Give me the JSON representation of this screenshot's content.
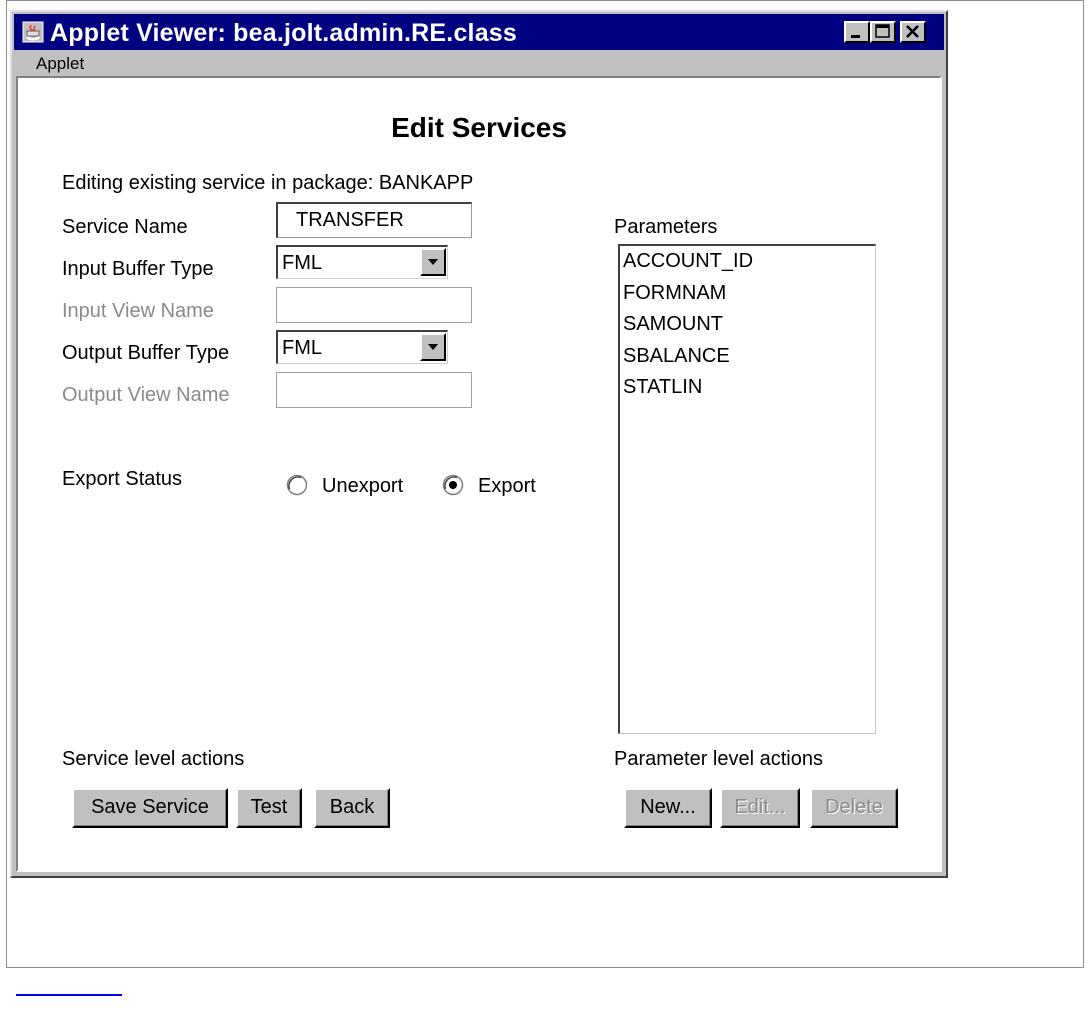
{
  "window": {
    "title": "Applet Viewer: bea.jolt.admin.RE.class"
  },
  "menu": {
    "items": [
      "Applet"
    ]
  },
  "page": {
    "title": "Edit Services",
    "subtitle": "Editing existing service in package: BANKAPP"
  },
  "form": {
    "service_name_label": "Service Name",
    "service_name_value": "TRANSFER",
    "input_buffer_label": "Input Buffer Type",
    "input_buffer_value": "FML",
    "input_view_label": "Input View Name",
    "input_view_value": "",
    "output_buffer_label": "Output Buffer Type",
    "output_buffer_value": "FML",
    "output_view_label": "Output View Name",
    "output_view_value": "",
    "export_status_label": "Export Status",
    "radio_unexport_label": "Unexport",
    "radio_export_label": "Export",
    "export_selected": "Export"
  },
  "parameters": {
    "label": "Parameters",
    "items": [
      "ACCOUNT_ID",
      "FORMNAM",
      "SAMOUNT",
      "SBALANCE",
      "STATLIN"
    ]
  },
  "service_actions": {
    "label": "Service level actions",
    "save_label": "Save Service",
    "test_label": "Test",
    "back_label": "Back"
  },
  "parameter_actions": {
    "label": "Parameter level actions",
    "new_label": "New...",
    "edit_label": "Edit...",
    "delete_label": "Delete"
  },
  "colors": {
    "titlebar": "#000080",
    "window_face": "#c0c0c0",
    "disabled_text": "#8a8a8a"
  }
}
